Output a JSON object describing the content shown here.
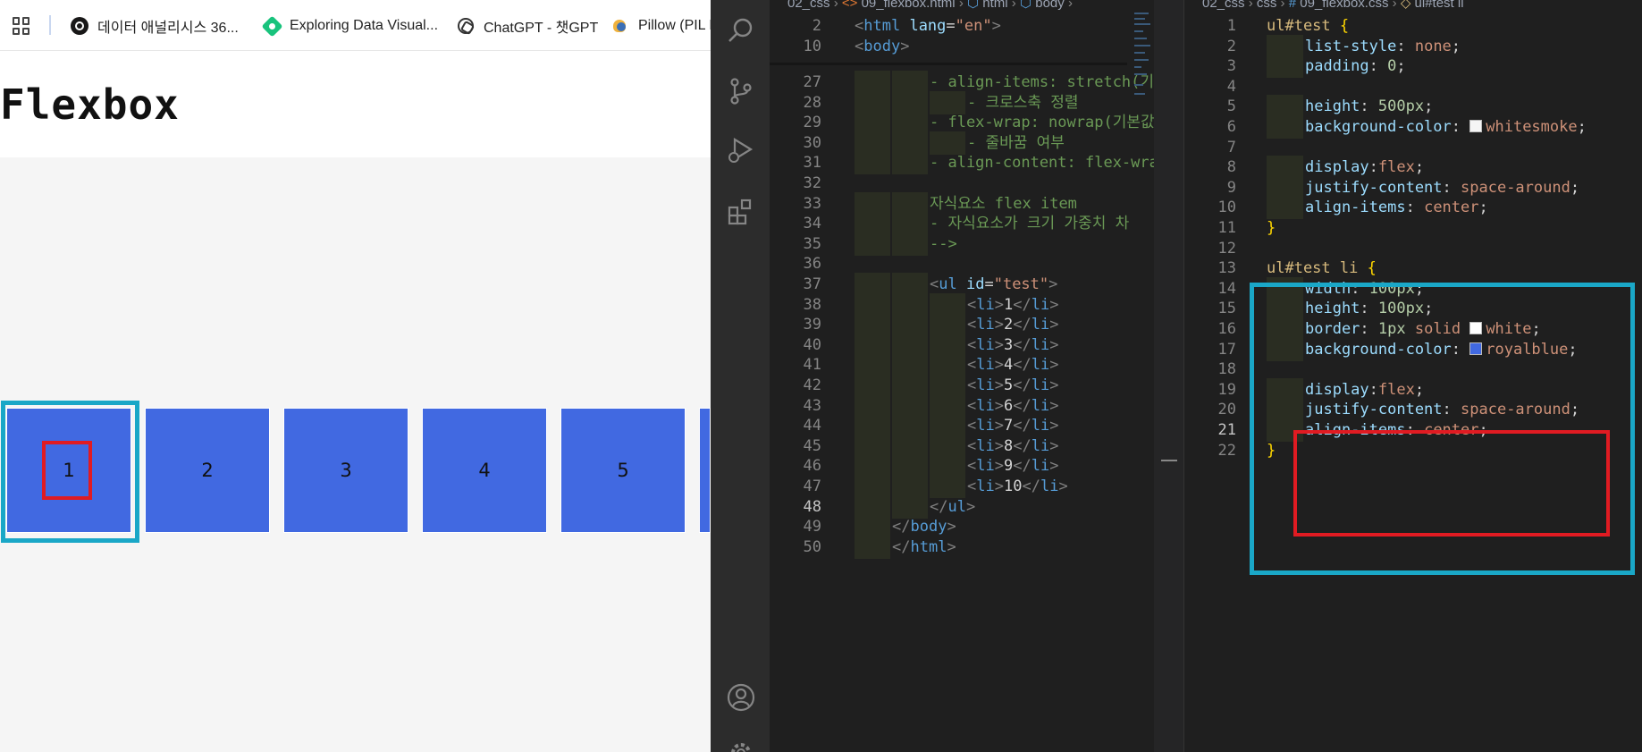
{
  "browser": {
    "bookmarks": [
      {
        "label": "데이터 애널리시스 36...",
        "icon": "github-icon"
      },
      {
        "label": "Exploring Data Visual...",
        "icon": "diamond-icon"
      },
      {
        "label": "ChatGPT - 챗GPT",
        "icon": "chatgpt-icon"
      },
      {
        "label": "Pillow (PIL F",
        "icon": "pillow-icon"
      }
    ],
    "page_title": "Flexbox",
    "container_color": "#f5f5f5",
    "item_color": "#4169e1",
    "items": [
      "1",
      "2",
      "3",
      "4",
      "5"
    ]
  },
  "editor_html": {
    "breadcrumb": {
      "folder": "02_css",
      "file": "09_flexbox.html",
      "path1": "html",
      "path2": "body"
    },
    "sticky": [
      {
        "num": "2",
        "text": "<html lang=\"en\">"
      },
      {
        "num": "10",
        "text": "<body>"
      }
    ],
    "lines": [
      {
        "num": "27",
        "indent": 2,
        "text": "- align-items: stretch(기"
      },
      {
        "num": "28",
        "indent": 3,
        "text": "- 크로스축 정렬"
      },
      {
        "num": "29",
        "indent": 2,
        "text": "- flex-wrap: nowrap(기본값"
      },
      {
        "num": "30",
        "indent": 3,
        "text": "- 줄바꿈 여부"
      },
      {
        "num": "31",
        "indent": 2,
        "text": "- align-content: flex-wra"
      },
      {
        "num": "32",
        "indent": 0,
        "text": ""
      },
      {
        "num": "33",
        "indent": 2,
        "text": "자식요소 flex item"
      },
      {
        "num": "34",
        "indent": 2,
        "text": "- 자식요소가 크기 가중치 차"
      },
      {
        "num": "35",
        "indent": 2,
        "text": "-->"
      },
      {
        "num": "36",
        "indent": 0,
        "text": ""
      },
      {
        "num": "37",
        "indent": 2,
        "text": "<ul id=\"test\">"
      },
      {
        "num": "38",
        "indent": 3,
        "text": "<li>1</li>"
      },
      {
        "num": "39",
        "indent": 3,
        "text": "<li>2</li>"
      },
      {
        "num": "40",
        "indent": 3,
        "text": "<li>3</li>"
      },
      {
        "num": "41",
        "indent": 3,
        "text": "<li>4</li>"
      },
      {
        "num": "42",
        "indent": 3,
        "text": "<li>5</li>"
      },
      {
        "num": "43",
        "indent": 3,
        "text": "<li>6</li>"
      },
      {
        "num": "44",
        "indent": 3,
        "text": "<li>7</li>"
      },
      {
        "num": "45",
        "indent": 3,
        "text": "<li>8</li>"
      },
      {
        "num": "46",
        "indent": 3,
        "text": "<li>9</li>"
      },
      {
        "num": "47",
        "indent": 3,
        "text": "<li>10</li>"
      },
      {
        "num": "48",
        "indent": 2,
        "text": "</ul>",
        "active": true
      },
      {
        "num": "49",
        "indent": 1,
        "text": "</body>"
      },
      {
        "num": "50",
        "indent": 1,
        "text": "</html>"
      }
    ]
  },
  "editor_css": {
    "breadcrumb": {
      "folder": "02_css",
      "sub": "css",
      "file": "09_flexbox.css",
      "symbol": "ul#test li"
    },
    "lines": [
      {
        "num": "1",
        "kind": "sel",
        "text": "ul#test"
      },
      {
        "num": "2",
        "kind": "decl",
        "prop": "list-style",
        "value": "none"
      },
      {
        "num": "3",
        "kind": "decl",
        "prop": "padding",
        "value": "0",
        "numeric": true
      },
      {
        "num": "4",
        "kind": "blank"
      },
      {
        "num": "5",
        "kind": "decl",
        "prop": "height",
        "value": "500px",
        "numeric": true
      },
      {
        "num": "6",
        "kind": "decl",
        "prop": "background-color",
        "value": "whitesmoke",
        "swatch": "#f5f5f5"
      },
      {
        "num": "7",
        "kind": "blank"
      },
      {
        "num": "8",
        "kind": "decl",
        "prop": "display",
        "value": "flex",
        "nospace": true
      },
      {
        "num": "9",
        "kind": "decl",
        "prop": "justify-content",
        "value": "space-around"
      },
      {
        "num": "10",
        "kind": "decl",
        "prop": "align-items",
        "value": "center"
      },
      {
        "num": "11",
        "kind": "close"
      },
      {
        "num": "12",
        "kind": "blank"
      },
      {
        "num": "13",
        "kind": "sel",
        "text": "ul#test li"
      },
      {
        "num": "14",
        "kind": "decl",
        "prop": "width",
        "value": "100px",
        "numeric": true
      },
      {
        "num": "15",
        "kind": "decl",
        "prop": "height",
        "value": "100px",
        "numeric": true
      },
      {
        "num": "16",
        "kind": "border",
        "prop": "border",
        "v1": "1px",
        "v2": "solid",
        "v3": "white",
        "swatch": "#ffffff"
      },
      {
        "num": "17",
        "kind": "decl",
        "prop": "background-color",
        "value": "royalblue",
        "swatch": "#4169e1"
      },
      {
        "num": "18",
        "kind": "blank"
      },
      {
        "num": "19",
        "kind": "decl",
        "prop": "display",
        "value": "flex",
        "nospace": true
      },
      {
        "num": "20",
        "kind": "decl",
        "prop": "justify-content",
        "value": "space-around"
      },
      {
        "num": "21",
        "kind": "decl",
        "prop": "align-items",
        "value": "center",
        "active": true
      },
      {
        "num": "22",
        "kind": "close"
      }
    ]
  },
  "annotations": {
    "rule_box_color": "#1aa7c7",
    "flex_box_color": "#e01b22"
  },
  "activity_icons": [
    "search-icon",
    "source-control-icon",
    "run-debug-icon",
    "extensions-icon",
    "account-icon",
    "settings-icon"
  ]
}
